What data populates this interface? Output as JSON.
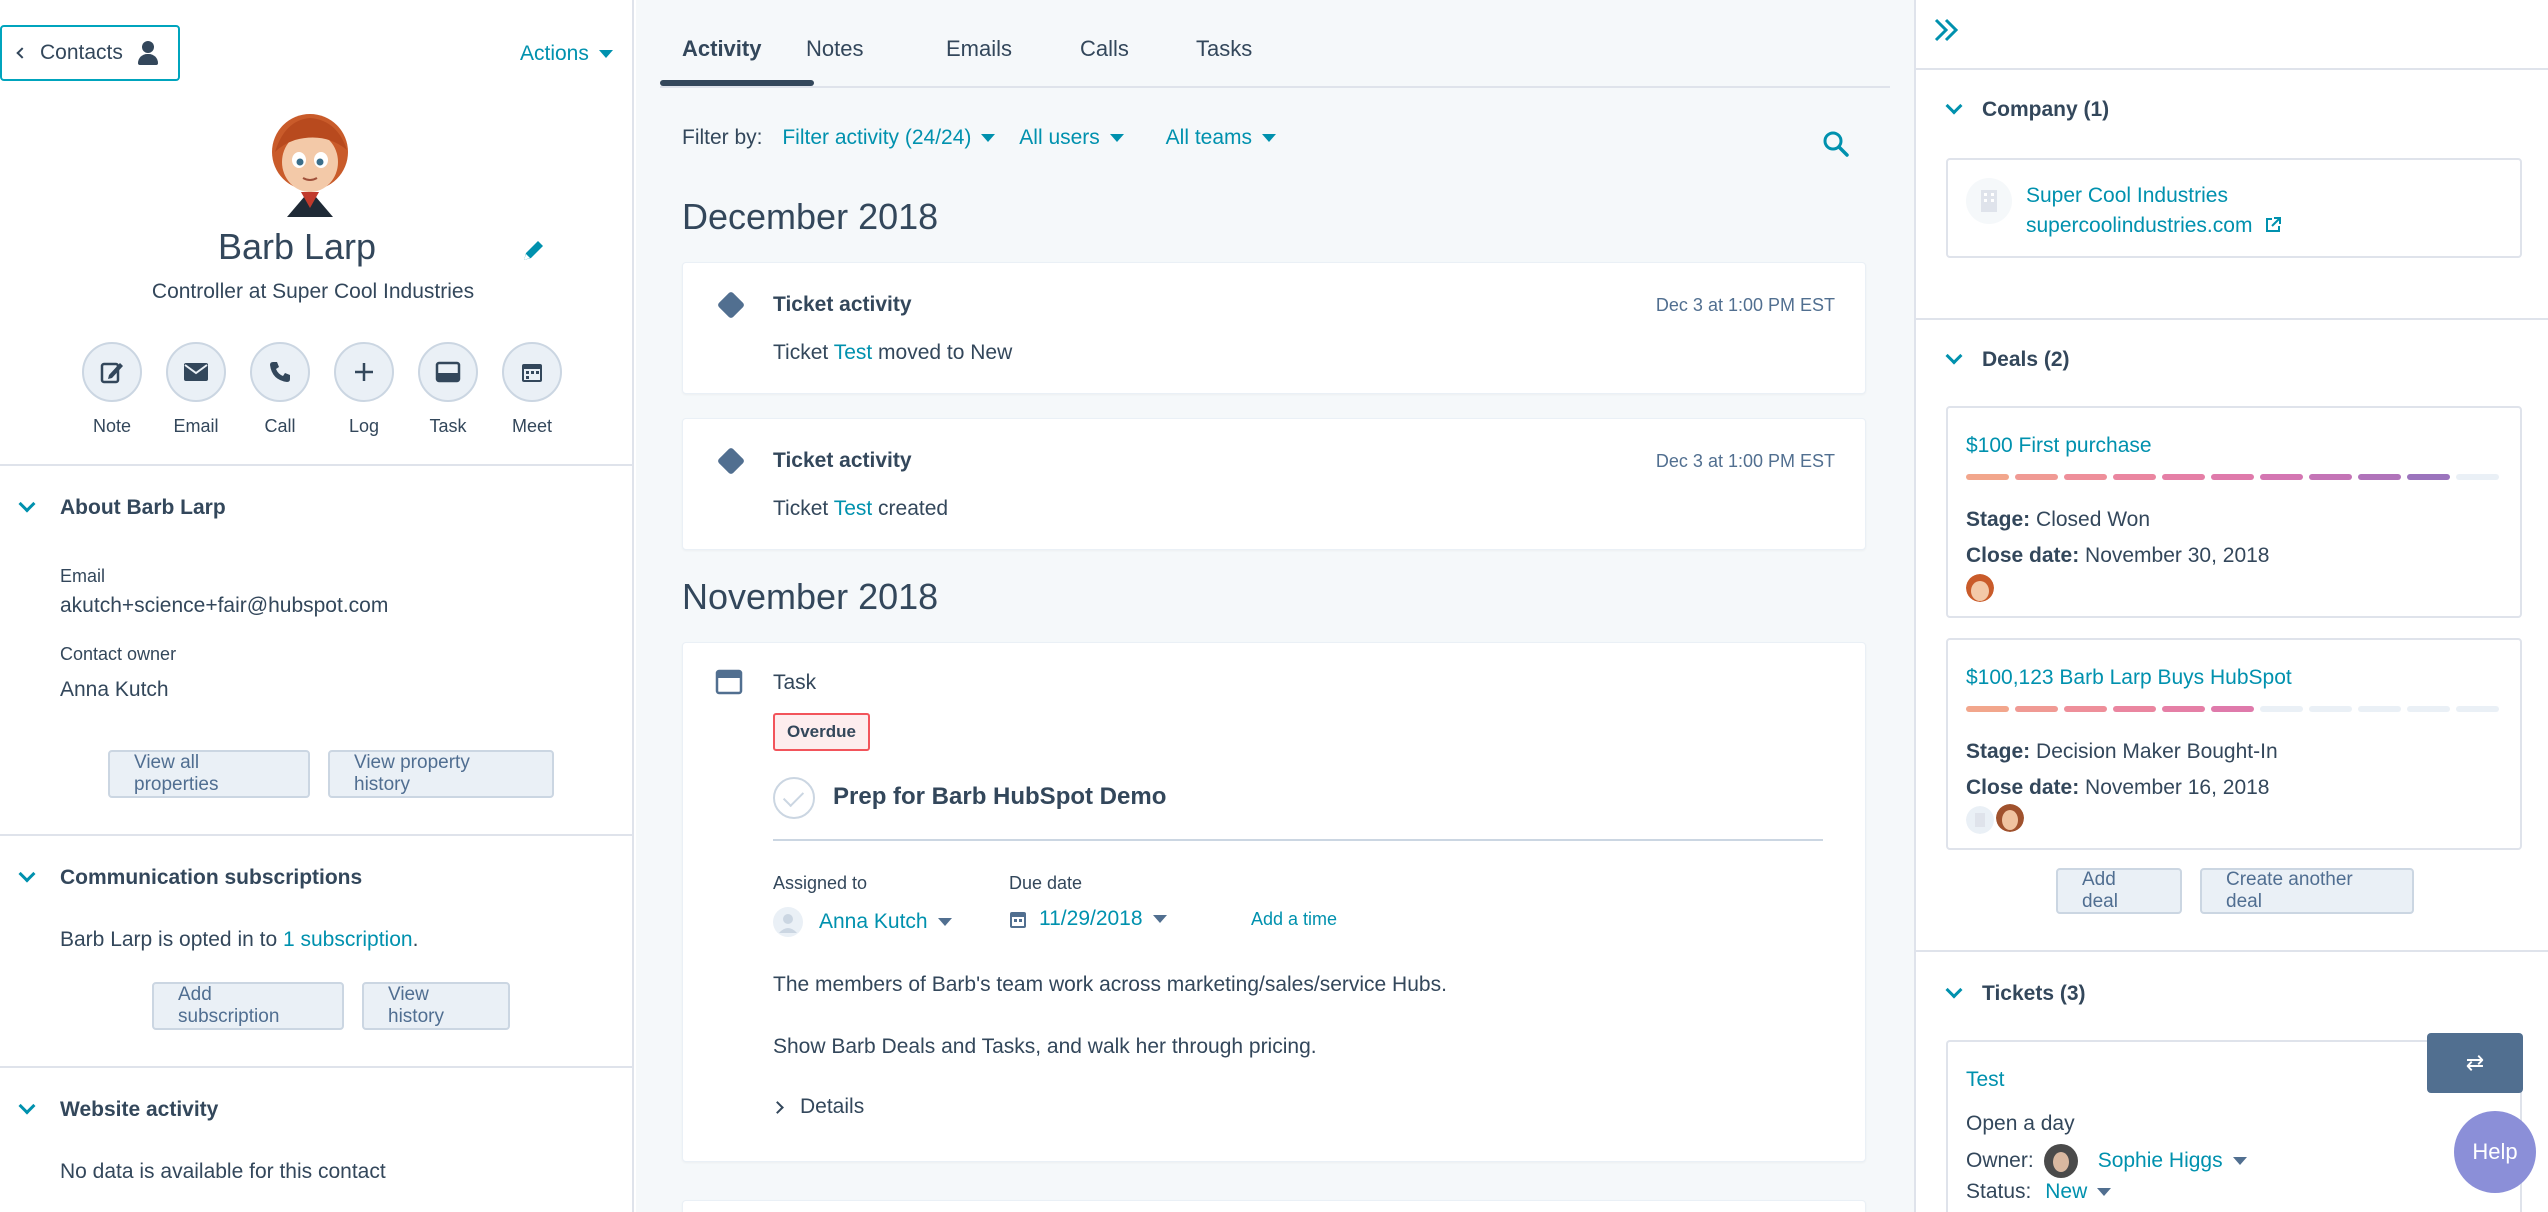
{
  "left": {
    "contacts_label": "Contacts",
    "actions_label": "Actions",
    "name": "Barb Larp",
    "job_title": "Controller at Super Cool Industries",
    "quick_actions": [
      "Note",
      "Email",
      "Call",
      "Log",
      "Task",
      "Meet"
    ],
    "about": {
      "heading": "About Barb Larp",
      "email_label": "Email",
      "email_value": "akutch+science+fair@hubspot.com",
      "owner_label": "Contact owner",
      "owner_value": "Anna Kutch",
      "view_all": "View all properties",
      "view_history": "View property history"
    },
    "comm": {
      "heading": "Communication subscriptions",
      "text_before": "Barb Larp is opted in to ",
      "link": "1 subscription",
      "text_after": ".",
      "add_btn": "Add subscription",
      "history_btn": "View history"
    },
    "web": {
      "heading": "Website activity",
      "text": "No data is available for this contact"
    }
  },
  "middle": {
    "tabs": [
      "Activity",
      "Notes",
      "Emails",
      "Calls",
      "Tasks"
    ],
    "filter_label": "Filter by:",
    "filter_activity": "Filter activity (24/24)",
    "all_users": "All users",
    "all_teams": "All teams",
    "month1": "December 2018",
    "month2": "November 2018",
    "ticket1": {
      "title": "Ticket activity",
      "time": "Dec 3 at 1:00 PM EST",
      "pre": "Ticket ",
      "link": "Test",
      "post": " moved to New"
    },
    "ticket2": {
      "title": "Ticket activity",
      "time": "Dec 3 at 1:00 PM EST",
      "pre": "Ticket ",
      "link": "Test",
      "post": " created"
    },
    "task": {
      "type": "Task",
      "badge": "Overdue",
      "title": "Prep for Barb HubSpot Demo",
      "assigned_label": "Assigned to",
      "assigned_value": "Anna Kutch",
      "due_label": "Due date",
      "due_value": "11/29/2018",
      "add_time": "Add a time",
      "line1": "The members of Barb's team work across marketing/sales/service Hubs.",
      "line2": "Show Barb Deals and Tasks, and walk her through pricing.",
      "details": "Details"
    }
  },
  "right": {
    "company_heading": "Company (1)",
    "company_name": "Super Cool Industries",
    "company_domain": "supercoolindustries.com",
    "deals_heading": "Deals (2)",
    "deal1": {
      "title": "$100 First purchase",
      "stage_label": "Stage:",
      "stage": " Closed Won",
      "close_label": "Close date:",
      "close": " November 30, 2018",
      "progress": 1.0
    },
    "deal2": {
      "title": "$100,123 Barb Larp Buys HubSpot",
      "stage_label": "Stage:",
      "stage": " Decision Maker Bought-In",
      "close_label": "Close date:",
      "close": " November 16, 2018",
      "progress": 0.6
    },
    "add_deal": "Add deal",
    "create_deal": "Create another deal",
    "tickets_heading": "Tickets (3)",
    "ticket": {
      "title": "Test",
      "open": "Open a day",
      "owner_label": "Owner:",
      "owner": "Sophie Higgs",
      "status_label": "Status:",
      "status": "New"
    }
  },
  "floating": {
    "switch_glyph": "⇄",
    "help": "Help"
  },
  "colors": {
    "accent": "#0091ae",
    "text": "#33475b",
    "overdue": "#f2545b"
  }
}
